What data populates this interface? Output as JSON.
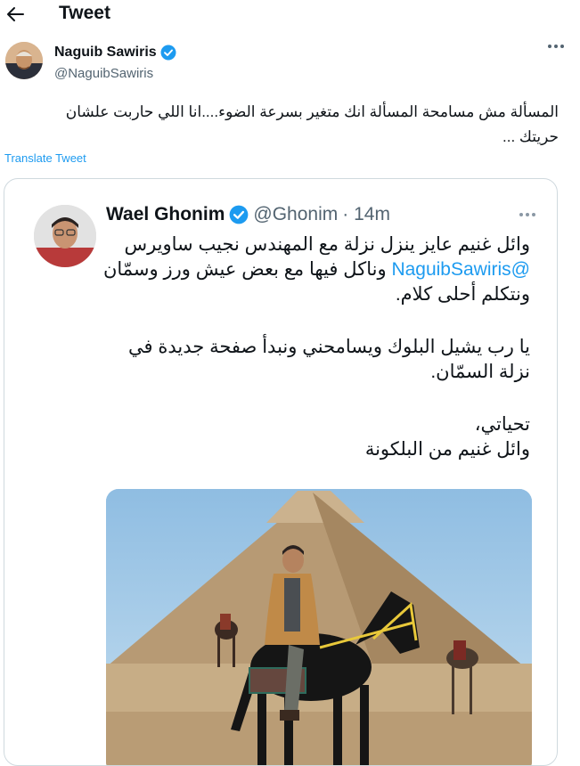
{
  "header": {
    "title": "Tweet",
    "back_icon": "arrow-left-icon"
  },
  "tweet": {
    "author_name": "Naguib Sawiris",
    "author_handle": "@NaguibSawiris",
    "verified": true,
    "text": "المسألة مش مسامحة المسألة انك متغير بسرعة الضوء....انا اللي حاربت علشان حريتك ...",
    "translate_label": "Translate Tweet"
  },
  "quoted": {
    "author_name": "Wael Ghonim",
    "author_handle": "@Ghonim",
    "time": "· 14m",
    "verified": true,
    "line1": "وائل غنيم عايز ينزل نزلة مع المهندس نجيب ساويرس",
    "mention": "@NaguibSawiris",
    "line1_rest": "وناكل فيها مع بعض عيش ورز وسمّان ونتكلم أحلى كلام.",
    "para2": "يا رب يشيل البلوك ويسامحني ونبدأ صفحة جديدة في نزلة السمّان.",
    "sign1": "تحياتي،",
    "sign2": "وائل غنيم من البلكونة"
  },
  "colors": {
    "accent": "#1d9bf0",
    "text": "#0f1419",
    "muted": "#536471",
    "border": "#cfd9de"
  }
}
